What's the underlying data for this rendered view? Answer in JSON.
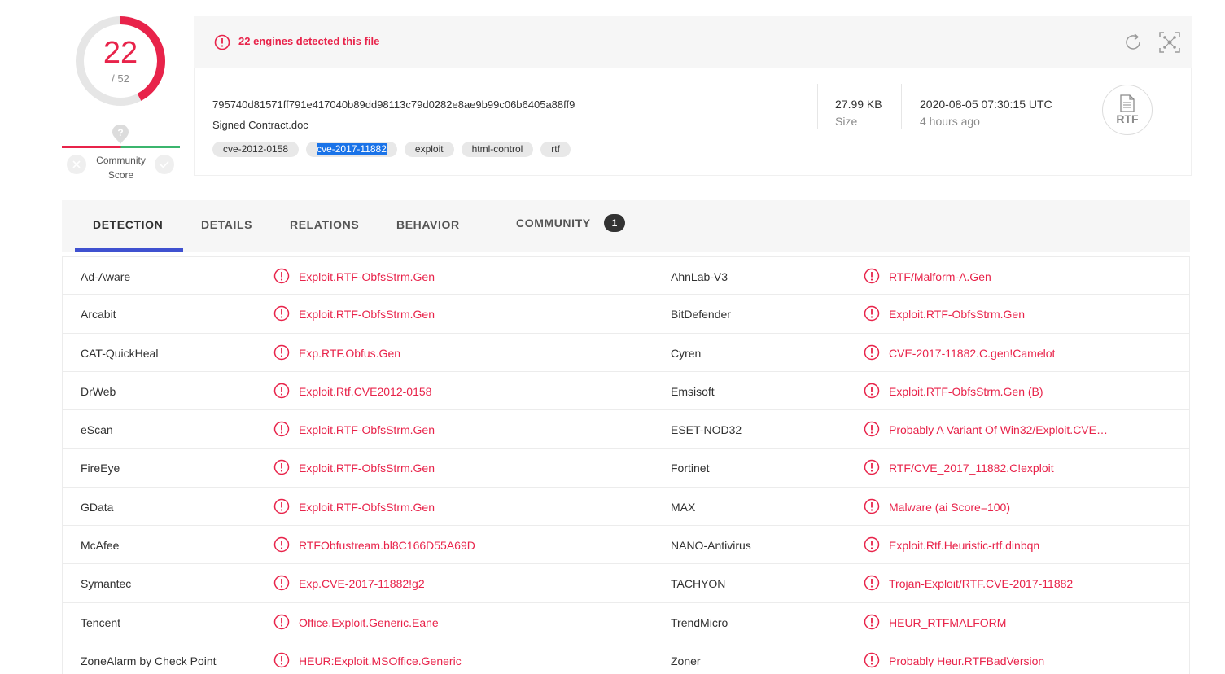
{
  "score": {
    "detected": "22",
    "total": "/ 52",
    "detected_fraction": 0.423
  },
  "community": {
    "label_line1": "Community",
    "label_line2": "Score"
  },
  "alert": {
    "text": "22 engines detected this file"
  },
  "file": {
    "hash": "795740d81571ff791e417040b89dd98113c79d0282e8ae9b99c06b6405a88ff9",
    "name": "Signed Contract.doc",
    "tags": [
      "cve-2012-0158",
      "cve-2017-11882",
      "exploit",
      "html-control",
      "rtf"
    ],
    "selected_tag_index": 1,
    "size_value": "27.99 KB",
    "size_label": "Size",
    "date_value": "2020-08-05 07:30:15 UTC",
    "date_relative": "4 hours ago",
    "type_badge": "RTF"
  },
  "tabs": {
    "detection": "DETECTION",
    "details": "DETAILS",
    "relations": "RELATIONS",
    "behavior": "BEHAVIOR",
    "community": "COMMUNITY",
    "community_count": "1"
  },
  "colors": {
    "alert": "#e8234a",
    "tab_underline": "#3f51d0",
    "positive": "#3bb56d"
  },
  "detections": [
    {
      "left_engine": "Ad-Aware",
      "left_result": "Exploit.RTF-ObfsStrm.Gen",
      "right_engine": "AhnLab-V3",
      "right_result": "RTF/Malform-A.Gen"
    },
    {
      "left_engine": "Arcabit",
      "left_result": "Exploit.RTF-ObfsStrm.Gen",
      "right_engine": "BitDefender",
      "right_result": "Exploit.RTF-ObfsStrm.Gen"
    },
    {
      "left_engine": "CAT-QuickHeal",
      "left_result": "Exp.RTF.Obfus.Gen",
      "right_engine": "Cyren",
      "right_result": "CVE-2017-11882.C.gen!Camelot"
    },
    {
      "left_engine": "DrWeb",
      "left_result": "Exploit.Rtf.CVE2012-0158",
      "right_engine": "Emsisoft",
      "right_result": "Exploit.RTF-ObfsStrm.Gen (B)"
    },
    {
      "left_engine": "eScan",
      "left_result": "Exploit.RTF-ObfsStrm.Gen",
      "right_engine": "ESET-NOD32",
      "right_result": "Probably A Variant Of Win32/Exploit.CVE…"
    },
    {
      "left_engine": "FireEye",
      "left_result": "Exploit.RTF-ObfsStrm.Gen",
      "right_engine": "Fortinet",
      "right_result": "RTF/CVE_2017_11882.C!exploit"
    },
    {
      "left_engine": "GData",
      "left_result": "Exploit.RTF-ObfsStrm.Gen",
      "right_engine": "MAX",
      "right_result": "Malware (ai Score=100)"
    },
    {
      "left_engine": "McAfee",
      "left_result": "RTFObfustream.bl8C166D55A69D",
      "right_engine": "NANO-Antivirus",
      "right_result": "Exploit.Rtf.Heuristic-rtf.dinbqn"
    },
    {
      "left_engine": "Symantec",
      "left_result": "Exp.CVE-2017-11882!g2",
      "right_engine": "TACHYON",
      "right_result": "Trojan-Exploit/RTF.CVE-2017-11882"
    },
    {
      "left_engine": "Tencent",
      "left_result": "Office.Exploit.Generic.Eane",
      "right_engine": "TrendMicro",
      "right_result": "HEUR_RTFMALFORM"
    },
    {
      "left_engine": "ZoneAlarm by Check Point",
      "left_result": "HEUR:Exploit.MSOffice.Generic",
      "right_engine": "Zoner",
      "right_result": "Probably Heur.RTFBadVersion"
    }
  ]
}
